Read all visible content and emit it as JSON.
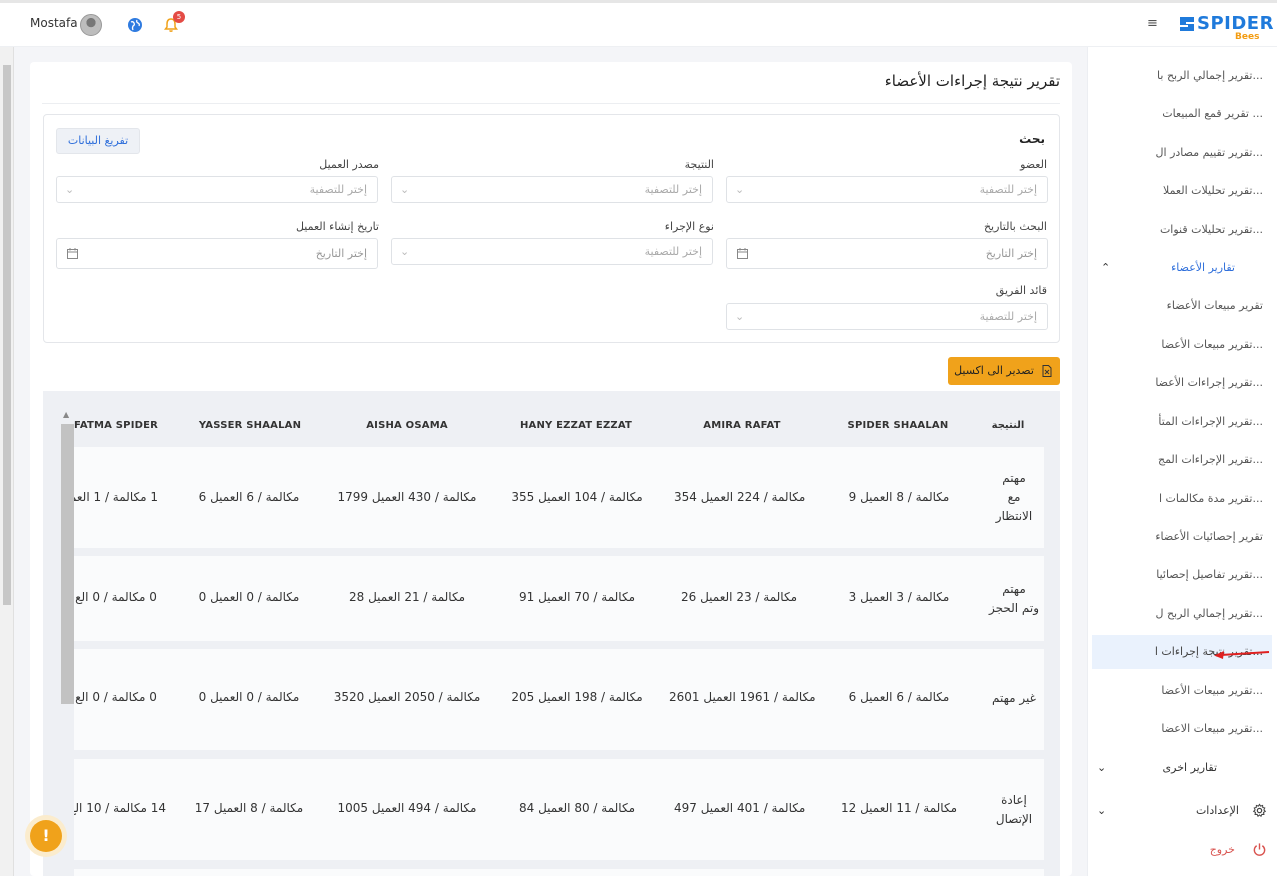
{
  "header": {
    "user_name": "Mostafa",
    "notification_count": "5",
    "logo_main": "SPIDER",
    "logo_sub": "Bees"
  },
  "sidebar": {
    "items_top": [
      "تقرير إجمالي الربح با...",
      "تقرير قمع المبيعات ...",
      "تقرير تقييم مصادر ال...",
      "تقرير تحليلات العملا...",
      "تقرير تحليلات قنوات..."
    ],
    "members_group": "تقارير الأعضاء",
    "members_items": [
      "تقرير مبيعات الأعضاء",
      "تقرير مبيعات الأعضا...",
      "تقرير إجراءات الأعضا...",
      "تقرير الإجراءات المتأ...",
      "تقرير الإجراءات المج...",
      "تقرير مدة مكالمات ا...",
      "تقرير إحصائيات الأعضاء",
      "تقرير تفاصيل إحصائيا...",
      "تقرير إجمالي الربح ل...",
      "تقرير نتيجة إجراءات ا...",
      "تقرير مبيعات الأعضا...",
      "تقرير مبيعات الاعضا..."
    ],
    "other_group": "تقارير اخرى",
    "settings_group": "الإعدادات",
    "logout": "خروج"
  },
  "page": {
    "title": "تقرير نتيجة إجراءات الأعضاء",
    "search_title": "بحث",
    "clear_button": "تفريغ البيانات",
    "export_button": "تصدير الى اكسيل"
  },
  "filters": {
    "member_label": "العضو",
    "result_label": "النتيجة",
    "client_source_label": "مصدر العميل",
    "date_search_label": "البحث بالتاريخ",
    "action_type_label": "نوع الإجراء",
    "client_created_label": "تاريخ إنشاء العميل",
    "team_leader_label": "قائد الفريق",
    "select_placeholder": "إختر للتصفية",
    "date_placeholder": "إختر التاريخ"
  },
  "table": {
    "result_header": "النتيجة",
    "columns": [
      "SPIDER SHAALAN",
      "AMIRA RAFAT",
      "HANY EZZAT EZZAT",
      "AISHA OSAMA",
      "YASSER SHAALAN",
      "FATMA SPIDER"
    ],
    "rows": [
      {
        "result_lines": [
          "مهتم",
          "مع",
          "الانتظار"
        ],
        "cells": [
          "9 مكالمة / 8 العميل",
          "354 مكالمة / 224 العميل",
          "355 مكالمة / 104 العميل",
          "1799 مكالمة / 430 العميل",
          "6 مكالمة / 6 العميل",
          "1 مكالمة / 1 العم"
        ]
      },
      {
        "result_lines": [
          "مهتم",
          "وتم الحجز"
        ],
        "cells": [
          "3 مكالمة / 3 العميل",
          "26 مكالمة / 23 العميل",
          "91 مكالمة / 70 العميل",
          "28 مكالمة / 21 العميل",
          "0 مكالمة / 0 العميل",
          "0 مكالمة / 0 الع"
        ]
      },
      {
        "result_lines": [
          "غير مهتم"
        ],
        "cells": [
          "6 مكالمة / 6 العميل",
          "2601 مكالمة / 1961 العميل",
          "205 مكالمة / 198 العميل",
          "3520 مكالمة / 2050 العميل",
          "0 مكالمة / 0 العميل",
          "0 مكالمة / 0 الع"
        ]
      },
      {
        "result_lines": [
          "إعادة",
          "الإتصال"
        ],
        "cells": [
          "12 مكالمة / 11 العميل",
          "497 مكالمة / 401 العميل",
          "84 مكالمة / 80 العميل",
          "1005 مكالمة / 494 العميل",
          "17 مكالمة / 8 العميل",
          "14 مكالمة / 10 الع"
        ]
      }
    ]
  },
  "colors": {
    "accent": "#f0a21b",
    "primary": "#2f6fdb",
    "active_bg": "#eaf2fd"
  }
}
